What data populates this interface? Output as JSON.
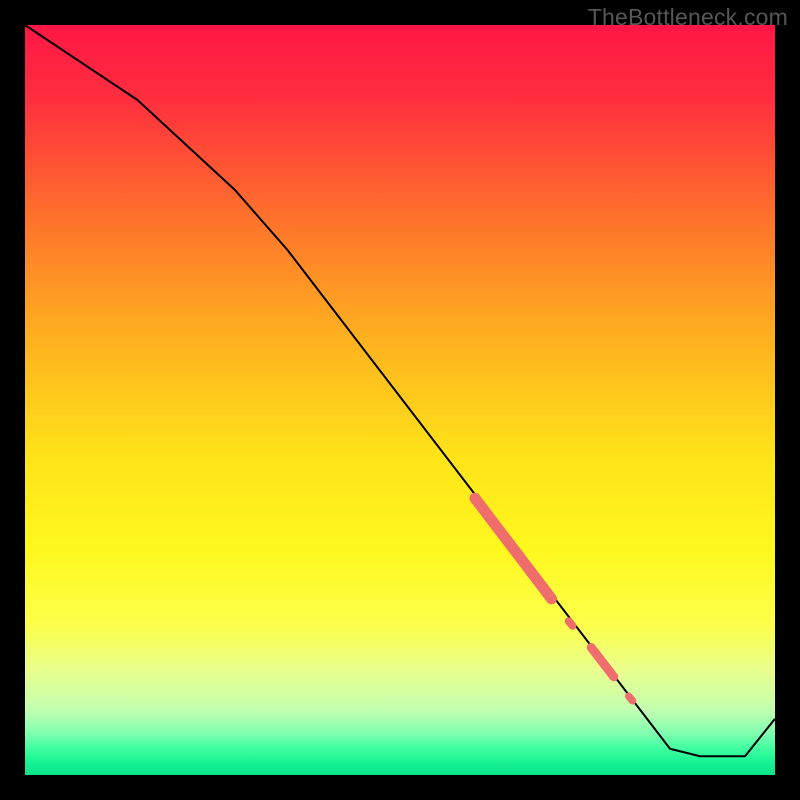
{
  "watermark": "TheBottleneck.com",
  "chart_data": {
    "type": "line",
    "title": "",
    "xlabel": "",
    "ylabel": "",
    "xlim": [
      0,
      100
    ],
    "ylim": [
      0,
      100
    ],
    "background_gradient": {
      "stops": [
        {
          "offset": 0.0,
          "color": "#ff1745"
        },
        {
          "offset": 0.1,
          "color": "#ff2f3e"
        },
        {
          "offset": 0.25,
          "color": "#ff6f2c"
        },
        {
          "offset": 0.42,
          "color": "#ffb21f"
        },
        {
          "offset": 0.58,
          "color": "#ffe419"
        },
        {
          "offset": 0.7,
          "color": "#fff81f"
        },
        {
          "offset": 0.8,
          "color": "#fbff4a"
        },
        {
          "offset": 0.86,
          "color": "#eaff8d"
        },
        {
          "offset": 0.915,
          "color": "#c0ffb0"
        },
        {
          "offset": 0.945,
          "color": "#7effaf"
        },
        {
          "offset": 0.965,
          "color": "#3effa0"
        },
        {
          "offset": 0.985,
          "color": "#14f191"
        },
        {
          "offset": 1.0,
          "color": "#0de38a"
        }
      ]
    },
    "series": [
      {
        "name": "curve",
        "x": [
          0.0,
          15.0,
          28.0,
          35.0,
          86.0,
          90.0,
          96.0,
          100.0
        ],
        "y": [
          100.0,
          90.0,
          78.0,
          70.0,
          3.5,
          2.5,
          2.5,
          7.5
        ],
        "color": "#000000",
        "width": 2.0
      }
    ],
    "highlight_segments": [
      {
        "x0": 60.0,
        "y0": 36.9,
        "x1": 70.2,
        "y1": 23.5,
        "radius": 5.5
      },
      {
        "x0": 72.5,
        "y0": 20.5,
        "x1": 73.0,
        "y1": 19.9,
        "radius": 4.0
      },
      {
        "x0": 75.5,
        "y0": 17.0,
        "x1": 78.5,
        "y1": 13.1,
        "radius": 4.5
      },
      {
        "x0": 80.5,
        "y0": 10.5,
        "x1": 81.0,
        "y1": 9.9,
        "radius": 3.8
      }
    ],
    "highlight_color": "#ef6e6b"
  }
}
